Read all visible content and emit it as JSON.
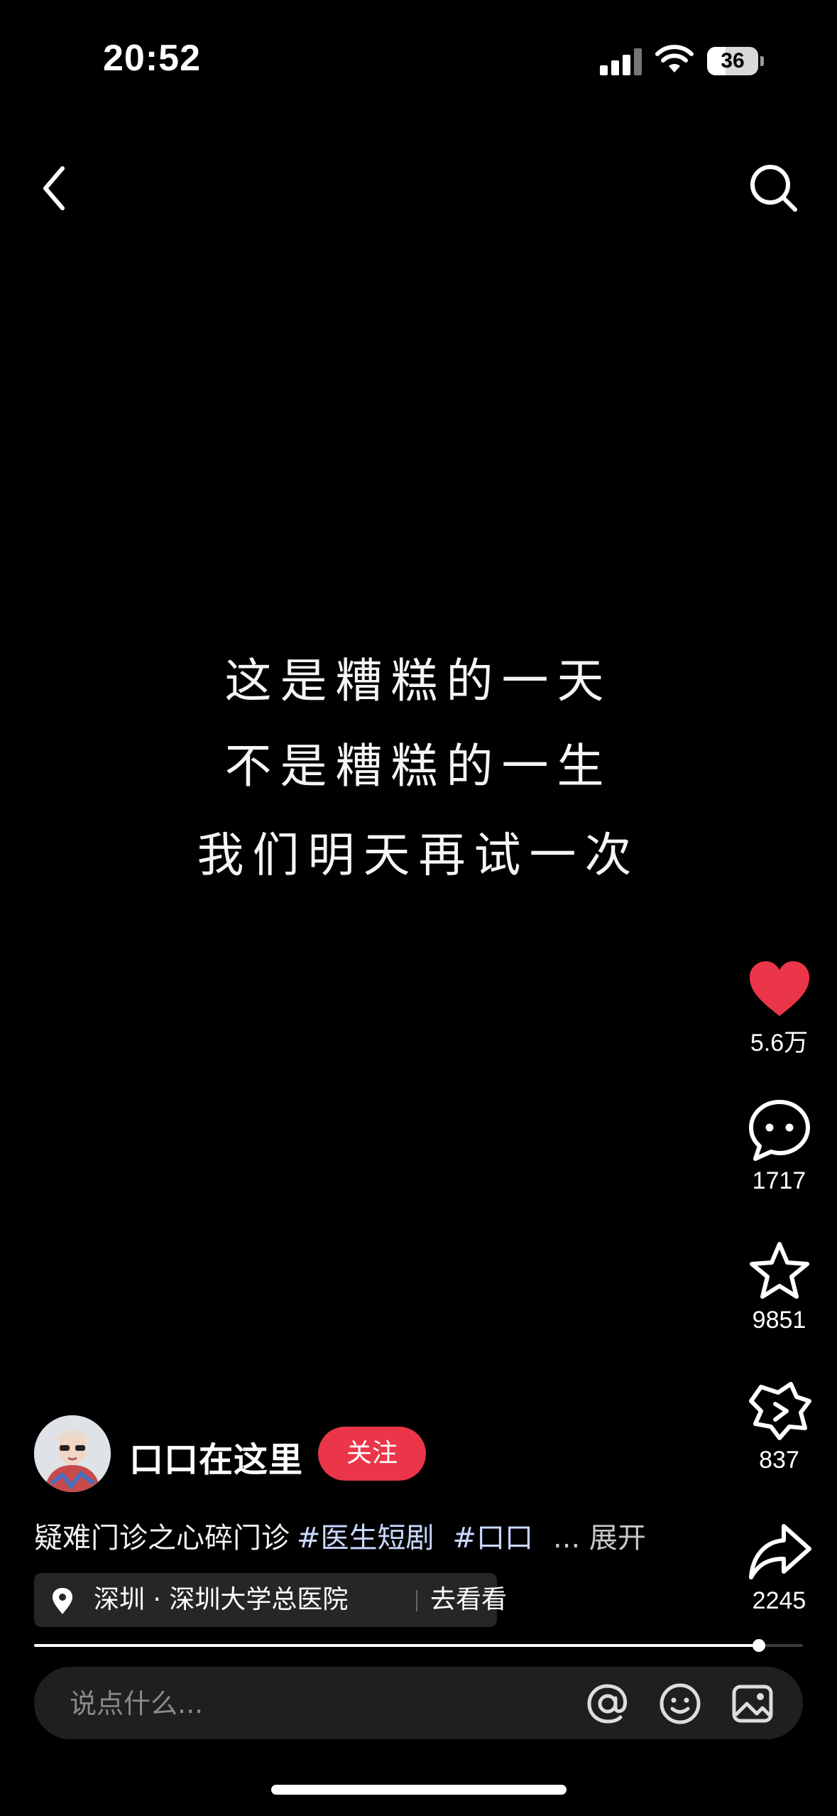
{
  "status_bar": {
    "time": "20:52",
    "battery": "36",
    "battery_level": 0.36
  },
  "video": {
    "lines": [
      "这是糟糕的一天",
      "不是糟糕的一生",
      "我们明天再试一次"
    ]
  },
  "actions": {
    "like_count": "5.6万",
    "comment_count": "1717",
    "favorite_count": "9851",
    "share_friend_count": "837",
    "share_count": "2245",
    "like_color": "#ea3648"
  },
  "author": {
    "name": "口口在这里",
    "follow_label": "关注"
  },
  "caption": {
    "text": "疑难门诊之心碎门诊",
    "tag1": "#医生短剧",
    "tag2": "#口口",
    "more": "... 展开"
  },
  "location": {
    "place": "深圳 · 深圳大学总医院",
    "action": "去看看"
  },
  "progress": {
    "fraction": 0.943
  },
  "comment_bar": {
    "placeholder": "说点什么..."
  },
  "icons": [
    "back-icon",
    "search-icon",
    "heart-icon",
    "comment-icon",
    "star-icon",
    "share-friend-icon",
    "share-icon",
    "location-pin-icon",
    "at-icon",
    "emoji-icon",
    "image-icon"
  ]
}
